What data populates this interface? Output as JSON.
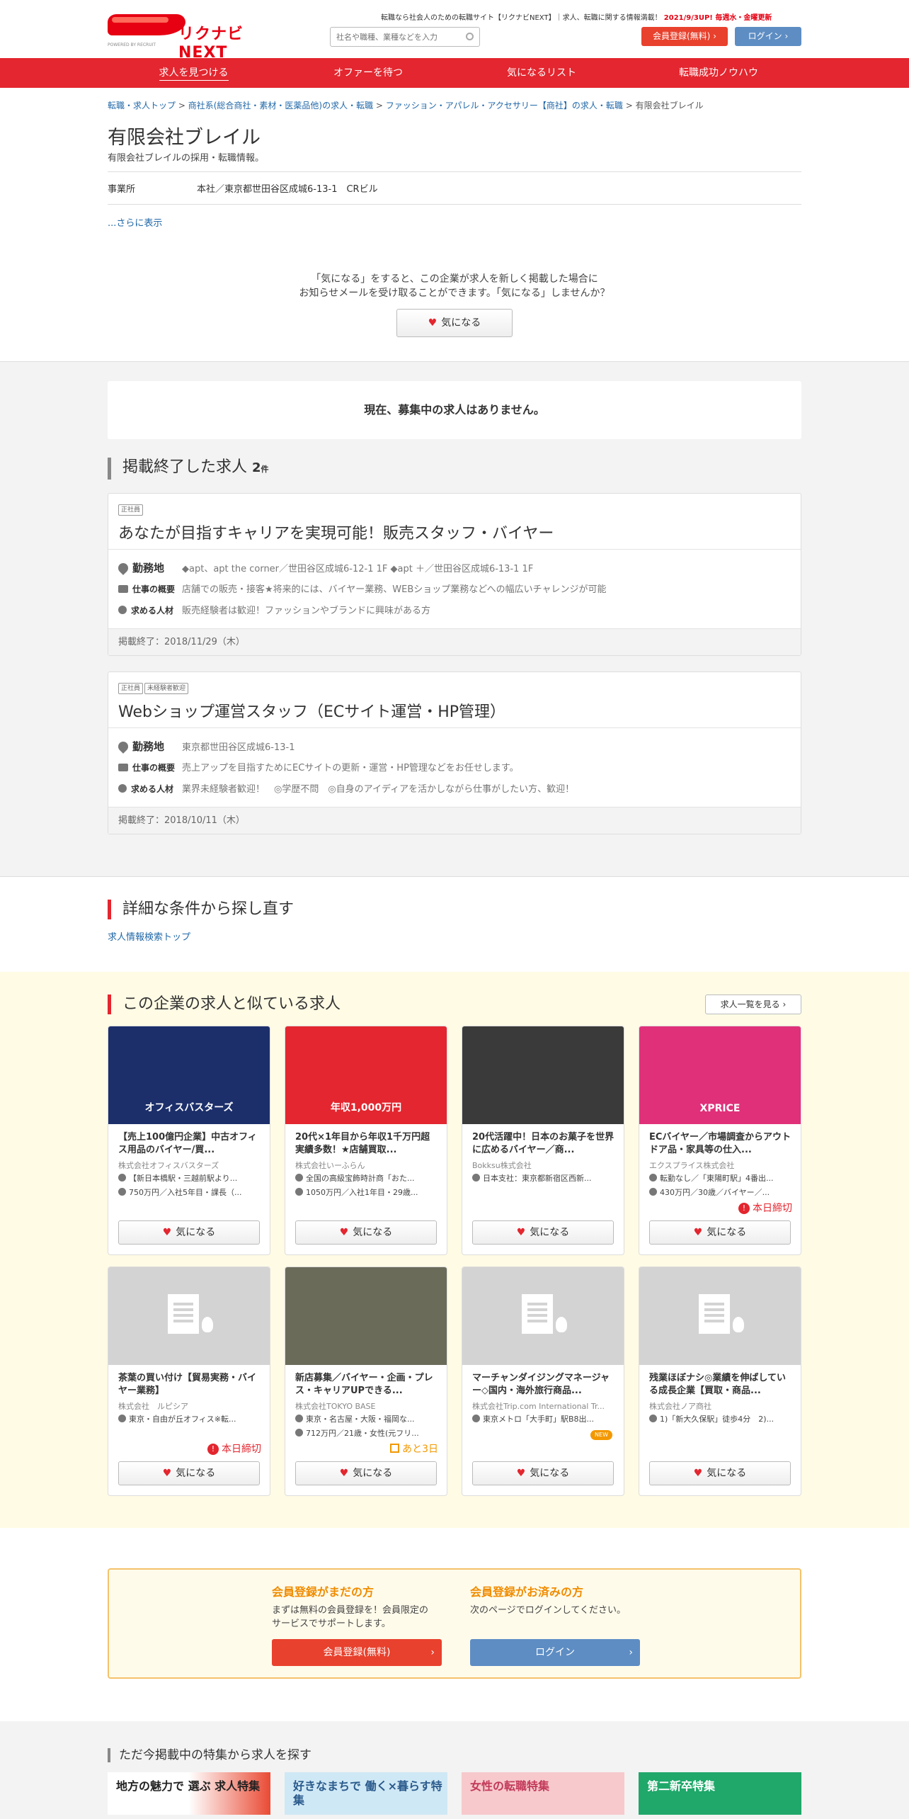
{
  "header": {
    "brand": "リクナビNEXT",
    "powered_by": "POWERED BY RECRUIT",
    "tagline": "転職なら社会人のための転職サイト【リクナビNEXT】｜求人、転職に関する情報満載！",
    "tagline_update": "2021/9/3UP! 毎週水・金曜更新",
    "search_placeholder": "社名や職種、業種などを入力",
    "register_label": "会員登録(無料)",
    "login_label": "ログイン"
  },
  "nav": [
    "求人を見つける",
    "オファーを待つ",
    "気になるリスト",
    "転職成功ノウハウ"
  ],
  "breadcrumb": [
    "転職・求人トップ",
    "商社系(総合商社・素材・医薬品他)の求人・転職",
    "ファッション・アパレル・アクセサリー【商社】の求人・転職",
    "有限会社ブレイル"
  ],
  "company": {
    "name": "有限会社ブレイル",
    "desc": "有限会社ブレイルの採用・転職情報。",
    "office_label": "事業所",
    "office_value": "本社／東京都世田谷区成城6-13-1　CRビル",
    "more": "...さらに表示",
    "fav_msg1": "「気になる」をすると、この企業が求人を新しく掲載した場合に",
    "fav_msg2": "お知らせメールを受け取ることができます。「気になる」しませんか？",
    "fav_label": "気になる"
  },
  "no_jobs": "現在、募集中の求人はありません。",
  "ended": {
    "title": "掲載終了した求人",
    "count": "2",
    "count_unit": "件",
    "jobs": [
      {
        "tags": [
          "正社員"
        ],
        "title": "あなたが目指すキャリアを実現可能！販売スタッフ・バイヤー",
        "loc_label": "勤務地",
        "loc": "◆apt、apt the corner／世田谷区成城6-12-1 1F ◆apt ＋／世田谷区成城6-13-1 1F",
        "work_label": "仕事の概要",
        "work": "店舗での販売・接客★将来的には、バイヤー業務、WEBショップ業務などへの幅広いチャレンジが可能",
        "req_label": "求める人材",
        "req": "販売経験者は歓迎！ファッションやブランドに興味がある方",
        "end": "掲載終了：2018/11/29（木）"
      },
      {
        "tags": [
          "正社員",
          "未経験者歓迎"
        ],
        "title": "Webショップ運営スタッフ（ECサイト運営・HP管理）",
        "loc_label": "勤務地",
        "loc": "東京都世田谷区成城6-13-1",
        "work_label": "仕事の概要",
        "work": "売上アップを目指すためにECサイトの更新・運営・HP管理などをお任せします。",
        "req_label": "求める人材",
        "req": "業界未経験者歓迎！　◎学歴不問　◎自身のアイディアを活かしながら仕事がしたい方、歓迎！",
        "end": "掲載終了：2018/10/11（木）"
      }
    ]
  },
  "research": {
    "title": "詳細な条件から探し直す",
    "link": "求人情報検索トップ"
  },
  "similar": {
    "title": "この企業の求人と似ている求人",
    "list_btn": "求人一覧を見る",
    "fav_label": "気になる",
    "cards": [
      {
        "title": "【売上100億円企業】中古オフィス用品のバイヤー/買...",
        "company": "株式会社オフィスバスターズ",
        "l1": "【新日本橋駅・三越前駅より...",
        "l2": "750万円／入社5年目・課長（...",
        "badge": "",
        "img_text": "オフィスバスターズ",
        "img_color": "#1c2f6b"
      },
      {
        "title": "20代×1年目から年収1千万円超実績多数！★店舗買取...",
        "company": "株式会社いーふらん",
        "l1": "全国の高級宝飾時計商「おた...",
        "l2": "1050万円／入社1年目・29歳...",
        "badge": "",
        "img_text": "年収1,000万円",
        "img_color": "#e3262f"
      },
      {
        "title": "20代活躍中！日本のお菓子を世界に広めるバイヤー／商...",
        "company": "Bokksu株式会社",
        "l1": "日本支社：東京都新宿区西新...",
        "l2": "",
        "badge": "",
        "img_text": "",
        "img_color": "#3a3a3a"
      },
      {
        "title": "ECバイヤー／市場調査からアウトドア品・家具等の仕入...",
        "company": "エクスプライス株式会社",
        "l1": "転勤なし／「東陽町駅」4番出...",
        "l2": "430万円／30歳／バイヤー／...",
        "badge": "本日締切",
        "img_text": "XPRICE",
        "img_color": "#e0307a"
      },
      {
        "title": "茶葉の買い付け【貿易実務・バイヤー業務】",
        "company": "株式会社　ルピシア",
        "l1": "東京・自由が丘オフィス※転...",
        "l2": "",
        "badge": "本日締切",
        "img_text": "",
        "img_color": ""
      },
      {
        "title": "新店募集／バイヤー・企画・プレス・キャリアUPできる...",
        "company": "株式会社TOKYO BASE",
        "l1": "東京・名古屋・大阪・福岡な...",
        "l2": "712万円／21歳・女性(元フリ...",
        "badge": "あと3日",
        "img_text": "",
        "img_color": "#6b6b5a"
      },
      {
        "title": "マーチャンダイジングマネージャー◇国内・海外旅行商品...",
        "company": "株式会社Trip.com International Tr...",
        "l1": "東京メトロ「大手町」駅B8出...",
        "l2": "",
        "badge": "NEW",
        "img_text": "",
        "img_color": ""
      },
      {
        "title": "残業ほぼナシ◎業績を伸ばしている成長企業【買取・商品...",
        "company": "株式会社ノア商社",
        "l1": "1)「新大久保駅」徒歩4分　2)...",
        "l2": "",
        "badge": "",
        "img_text": "",
        "img_color": ""
      }
    ]
  },
  "member": {
    "new_title": "会員登録がまだの方",
    "new_text1": "まずは無料の会員登録を！会員限定の",
    "new_text2": "サービスでサポートします。",
    "new_btn": "会員登録(無料)",
    "exist_title": "会員登録がお済みの方",
    "exist_text": "次のページでログインしてください。",
    "exist_btn": "ログイン"
  },
  "features": {
    "title": "ただ今掲載中の特集から求人を探す",
    "banners": [
      "地方の魅力で 選ぶ 求人特集",
      "好きなまちで 働く×暮らす特集",
      "女性の転職特集",
      "第二新卒特集"
    ]
  }
}
